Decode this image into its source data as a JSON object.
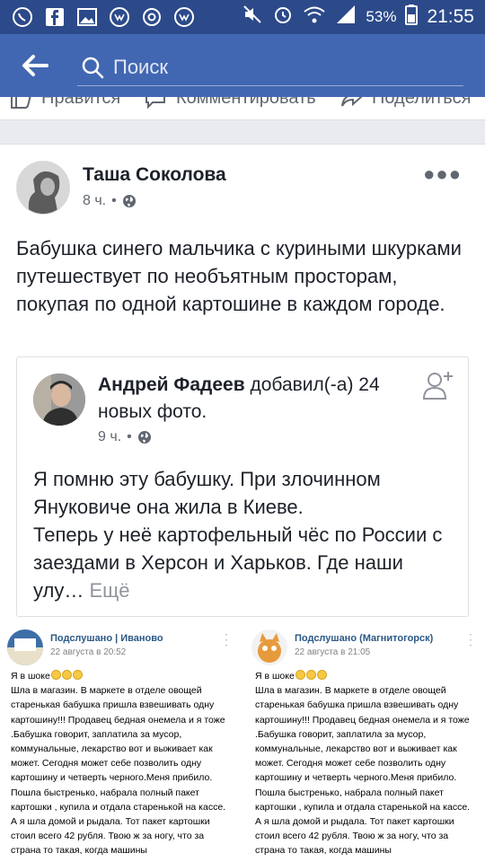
{
  "status_bar": {
    "time": "21:55",
    "battery": "53%",
    "left_icons": [
      "whatsapp-icon",
      "facebook-icon",
      "gallery-icon",
      "vk-icon",
      "at-icon",
      "vk-icon"
    ],
    "right_icons": [
      "mute-icon",
      "alarm-icon",
      "wifi-icon",
      "signal-icon"
    ]
  },
  "appbar": {
    "search_placeholder": "Поиск",
    "color": "#4267b2"
  },
  "action_strip": {
    "like": "Нравится",
    "comment": "Комментировать",
    "share": "Поделиться"
  },
  "post": {
    "author": "Таша Соколова",
    "time": "8 ч.",
    "separator": "•",
    "text": "Бабушка синего мальчика с куриными шкурками путешествует по необъятным просторам, покупая по одной картошине в каждом городе.",
    "shared": {
      "author": "Андрей Фадеев",
      "action": " добавил(-а) 24 новых фото.",
      "time": "9 ч.",
      "separator": "•",
      "text": "Я помню эту бабушку. При злочинном Януковиче она жила в Киеве.\nТеперь у неё картофельный чёс по России с заездами в Херсон  и Харьков. Где наши улу…",
      "more": "Ещё"
    }
  },
  "photos": [
    {
      "name": "Подслушано | Иваново",
      "date": "22 августа в 20:52",
      "lead": "Я в шоке",
      "text": "Шла в магазин. В маркете в отделе овощей старенькая бабушка пришла взвешивать одну картошину!!! Продавец бедная онемела и я тоже .Бабушка говорит, заплатила за мусор, коммунальные, лекарство вот и выживает как может. Сегодня может себе позволить одну картошину и четверть черного.Меня прибило. Пошла быстренько, набрала полный пакет картошки , купила и отдала старенькой на кассе. А я шла домой и рыдала. Тот пакет картошки стоил всего 42 рубля. Твою ж за ногу, что за страна то такая, когда машины"
    },
    {
      "name": "Подслушано (Магнитогорск)",
      "date": "22 августа в 21:05",
      "lead": "Я в шоке",
      "text": "Шла в магазин. В маркете в отделе овощей старенькая бабушка пришла взвешивать одну картошину!!! Продавец бедная онемела и я тоже .Бабушка говорит, заплатила за мусор, коммунальные, лекарство вот и выживает как может. Сегодня может себе позволить одну картошину и четверть черного.Меня прибило. Пошла быстренько, набрала полный пакет картошки , купила и отдала старенькой на кассе. А я шла домой и рыдала. Тот пакет картошки стоил всего 42 рубля. Твою ж за ногу, что за страна то такая, когда машины"
    }
  ]
}
